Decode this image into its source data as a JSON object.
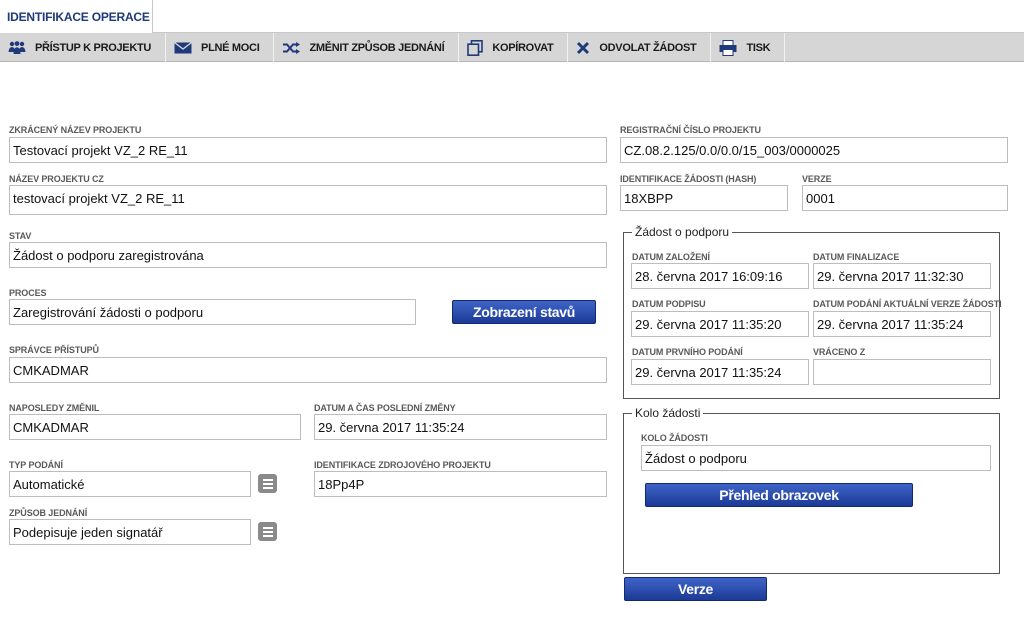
{
  "tabs": {
    "active": "IDENTIFIKACE OPERACE"
  },
  "toolbar": {
    "access": "PŘÍSTUP K PROJEKTU",
    "powers": "PLNÉ MOCI",
    "change": "ZMĚNIT ZPŮSOB JEDNÁNÍ",
    "copy": "KOPÍROVAT",
    "revoke": "ODVOLAT ŽÁDOST",
    "print": "TISK"
  },
  "form": {
    "short_name_label": "ZKRÁCENÝ NÁZEV PROJEKTU",
    "short_name": "Testovací projekt VZ_2  RE_11",
    "name_cz_label": "NÁZEV PROJEKTU CZ",
    "name_cz": "testovací projekt VZ_2 RE_11",
    "state_label": "STAV",
    "state": "Žádost o podporu zaregistrována",
    "process_label": "PROCES",
    "process": "Zaregistrování žádosti o podporu",
    "show_states": "Zobrazení stavů",
    "access_admin_label": "SPRÁVCE PŘÍSTUPŮ",
    "access_admin": "CMKADMAR",
    "last_changed_by_label": "NAPOSLEDY ZMĚNIL",
    "last_changed_by": "CMKADMAR",
    "last_change_label": "DATUM A ČAS POSLEDNÍ ZMĚNY",
    "last_change": "29. června 2017 11:35:24",
    "submit_type_label": "TYP PODÁNÍ",
    "submit_type": "Automatické",
    "source_id_label": "IDENTIFIKACE ZDROJOVÉHO PROJEKTU",
    "source_id": "18Pp4P",
    "acting_label": "ZPŮSOB JEDNÁNÍ",
    "acting": "Podepisuje jeden signatář",
    "reg_number_label": "REGISTRAČNÍ ČÍSLO PROJEKTU",
    "reg_number": "CZ.08.2.125/0.0/0.0/15_003/0000025",
    "hash_label": "IDENTIFIKACE ŽÁDOSTI (HASH)",
    "hash": "18XBPP",
    "version_label": "VERZE",
    "version": "0001"
  },
  "application": {
    "legend": "Žádost o podporu",
    "created_label": "DATUM ZALOŽENÍ",
    "created": "28. června 2017 16:09:16",
    "finalized_label": "DATUM FINALIZACE",
    "finalized": "29. června 2017 11:32:30",
    "signed_label": "DATUM PODPISU",
    "signed": "29. června 2017 11:35:20",
    "current_submit_label": "DATUM PODÁNÍ AKTUÁLNÍ VERZE ŽÁDOSTI",
    "current_submit": "29. června 2017 11:35:24",
    "first_submit_label": "DATUM PRVNÍHO PODÁNÍ",
    "first_submit": "29. června 2017 11:35:24",
    "returned_label": "VRÁCENO Z",
    "returned": ""
  },
  "round": {
    "legend": "Kolo žádosti",
    "label": "KOLO ŽÁDOSTI",
    "value": "Žádost o podporu",
    "screens_button": "Přehled obrazovek"
  },
  "verze_button": "Verze"
}
